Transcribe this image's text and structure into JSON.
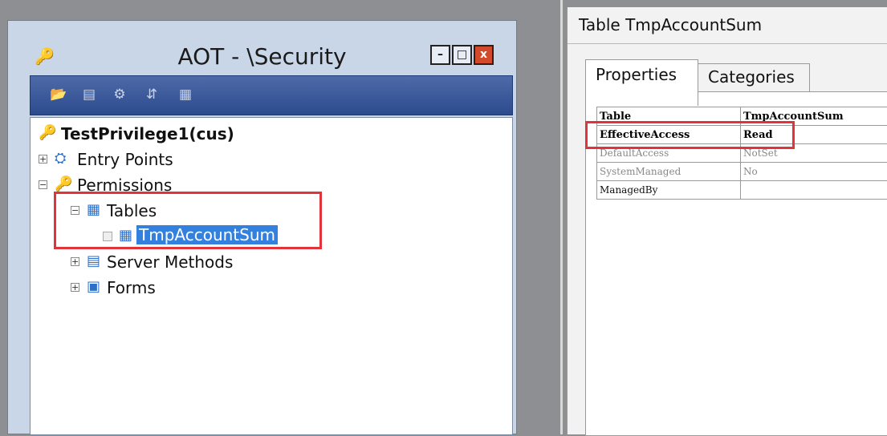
{
  "aot_window": {
    "title": "AOT - \\Security",
    "key_icon": "key-icon",
    "buttons": {
      "minimize": "–",
      "maximize": "□",
      "close": "x"
    },
    "toolbar_icons": [
      "open-folder-icon",
      "properties-icon",
      "compile-icon",
      "refresh-icon",
      "print-icon"
    ],
    "tree": {
      "root": {
        "label": "TestPrivilege1(cus)",
        "icon": "key-icon"
      },
      "entry_points": {
        "label": "Entry Points",
        "expander": "+",
        "icon": "entry-points-icon"
      },
      "permissions": {
        "label": "Permissions",
        "expander": "−",
        "icon": "key-icon"
      },
      "tables": {
        "label": "Tables",
        "expander": "−",
        "icon": "tables-folder-icon"
      },
      "tmp_account_sum": {
        "label": "TmpAccountSum",
        "icon": "table-icon"
      },
      "server_methods": {
        "label": "Server Methods",
        "expander": "+",
        "icon": "server-methods-icon"
      },
      "forms": {
        "label": "Forms",
        "expander": "+",
        "icon": "forms-icon"
      }
    }
  },
  "property_window": {
    "title": "Table TmpAccountSum",
    "tabs": {
      "properties": "Properties",
      "categories": "Categories"
    },
    "rows": [
      {
        "name": "Table",
        "value": "TmpAccountSum"
      },
      {
        "name": "EffectiveAccess",
        "value": "Read"
      },
      {
        "name": "DefaultAccess",
        "value": "NotSet"
      },
      {
        "name": "SystemManaged",
        "value": "No"
      },
      {
        "name": "ManagedBy",
        "value": ""
      }
    ]
  },
  "colors": {
    "highlight": "#e0333a",
    "selection": "#3380de",
    "toolbar": "#2c4b8e"
  }
}
